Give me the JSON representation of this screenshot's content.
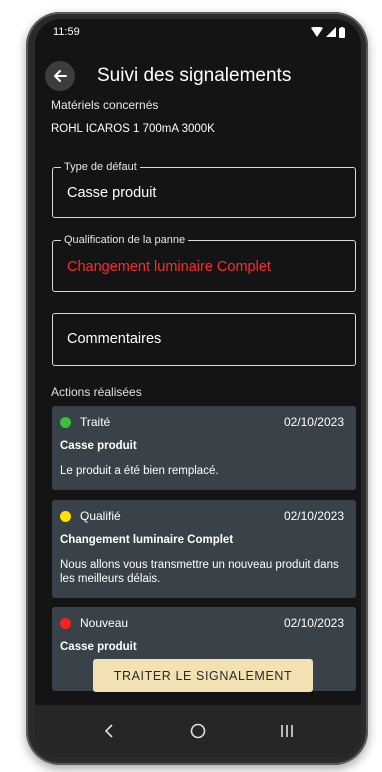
{
  "status_bar": {
    "time": "11:59"
  },
  "header": {
    "title": "Suivi des signalements"
  },
  "materials": {
    "label": "Matériels concernés",
    "value": "ROHL ICAROS 1 700mA 3000K"
  },
  "fields": {
    "defect_type": {
      "label": "Type de défaut",
      "value": "Casse produit",
      "color": "#ffffff"
    },
    "qualification": {
      "label": "Qualification de la panne",
      "value": "Changement luminaire Complet",
      "color": "#ff2a2a"
    },
    "comments": {
      "placeholder": "Commentaires"
    }
  },
  "actions": {
    "title": "Actions réalisées",
    "items": [
      {
        "status": "Traité",
        "status_color": "#3cc03c",
        "date": "02/10/2023",
        "title": "Casse produit",
        "text": "Le produit a été bien remplacé."
      },
      {
        "status": "Qualifié",
        "status_color": "#ffe000",
        "date": "02/10/2023",
        "title": "Changement luminaire Complet",
        "text": "Nous allons vous transmettre un nouveau produit dans les meilleurs délais."
      },
      {
        "status": "Nouveau",
        "status_color": "#ff1f1f",
        "date": "02/10/2023",
        "title": "Casse produit",
        "text": ""
      }
    ]
  },
  "cta": {
    "label": "TRAITER LE SIGNALEMENT"
  },
  "colors": {
    "background": "#141414",
    "card": "#3a4249",
    "cta": "#f2e2b3"
  },
  "icons": {
    "back": "arrow-left-icon",
    "wifi": "wifi-icon",
    "signal": "signal-icon",
    "battery": "battery-icon",
    "nav_back": "chevron-left-icon",
    "nav_home": "circle-home-icon",
    "nav_recents": "recents-icon"
  }
}
